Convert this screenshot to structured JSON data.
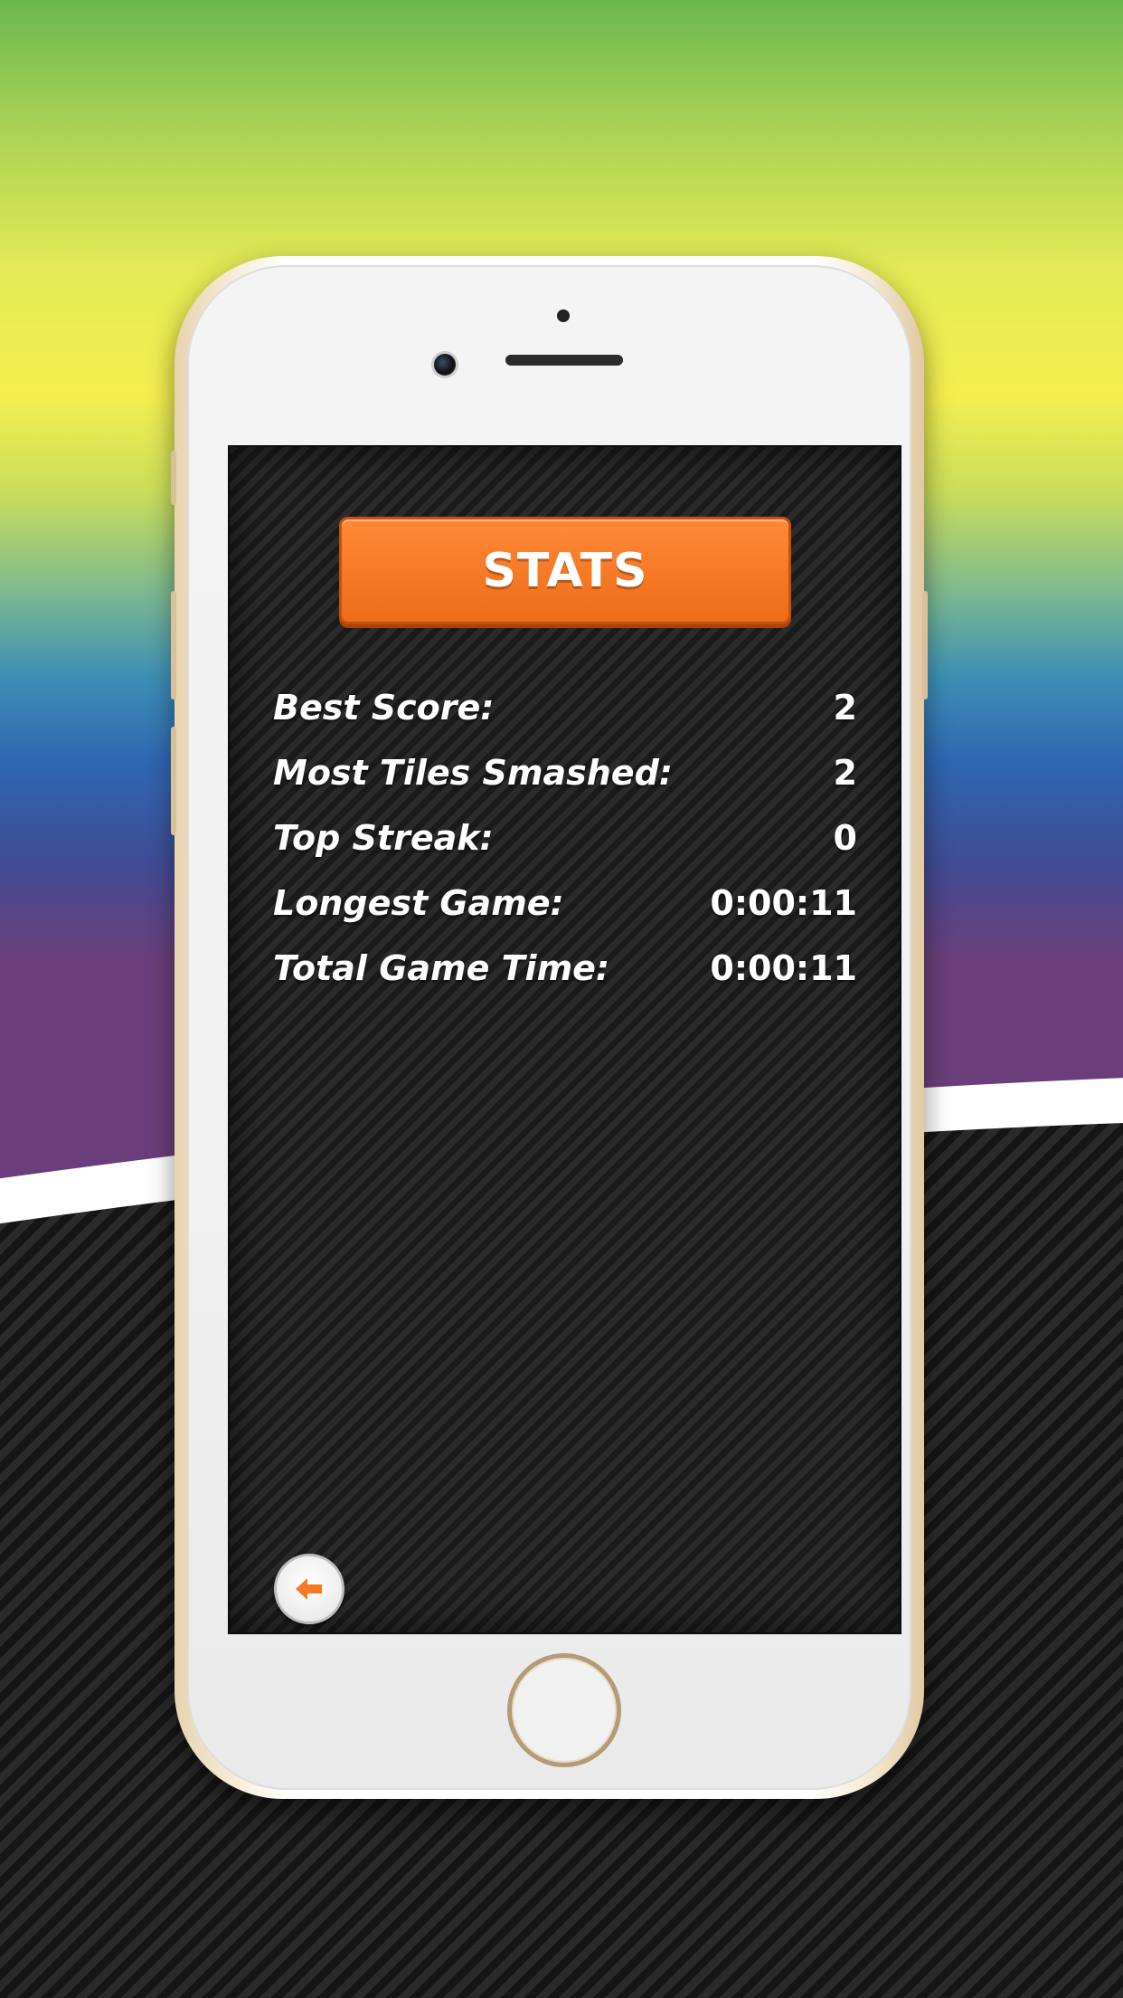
{
  "background": {
    "gradient_colors": [
      "#6ab84e",
      "#f5ee50",
      "#2f66b1",
      "#6a3e7a"
    ],
    "stripe_colors": [
      "#2a2a2a",
      "#151515"
    ]
  },
  "phone": {
    "color": "#f7ecd8"
  },
  "screen": {
    "title": "STATS",
    "accent_color": "#f77a27",
    "stats": [
      {
        "label": "Best Score:",
        "value": "2"
      },
      {
        "label": "Most Tiles Smashed:",
        "value": "2"
      },
      {
        "label": "Top Streak:",
        "value": "0"
      },
      {
        "label": "Longest Game:",
        "value": "0:00:11"
      },
      {
        "label": "Total Game Time:",
        "value": "0:00:11"
      }
    ],
    "back_button": {
      "icon": "arrow-left-icon"
    }
  }
}
